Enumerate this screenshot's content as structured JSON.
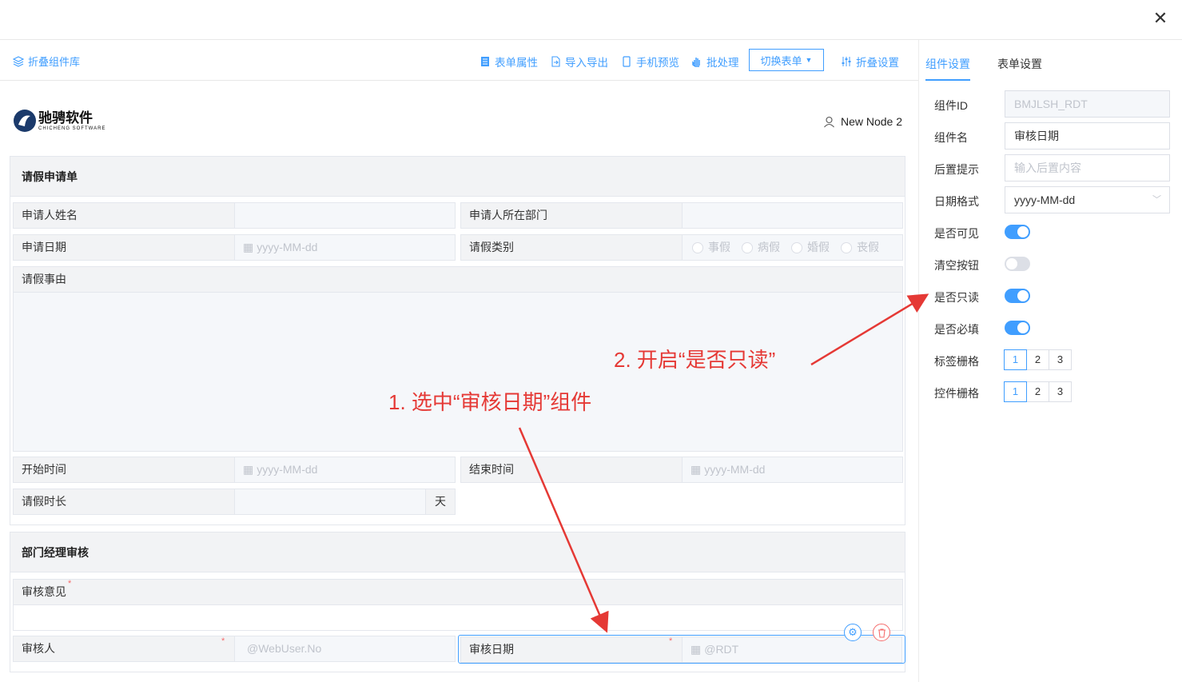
{
  "window": {
    "close_icon": "close-icon"
  },
  "toolbar": {
    "fold_lib": "折叠组件库",
    "form_props": "表单属性",
    "import_export": "导入导出",
    "mobile_preview": "手机预览",
    "batch": "批处理",
    "switch_form": "切换表单",
    "fold_settings": "折叠设置"
  },
  "header": {
    "logo_title": "驰骋软件",
    "logo_sub": "CHICHENG SOFTWARE",
    "node": "New Node 2"
  },
  "section1": {
    "title": "请假申请单",
    "applicant_name": "申请人姓名",
    "applicant_dept": "申请人所在部门",
    "apply_date": "申请日期",
    "date_ph": "yyyy-MM-dd",
    "leave_type": "请假类别",
    "leave_options": [
      "事假",
      "病假",
      "婚假",
      "丧假"
    ],
    "reason": "请假事由",
    "start_time": "开始时间",
    "end_time": "结束时间",
    "duration": "请假时长",
    "duration_unit": "天"
  },
  "section2": {
    "title": "部门经理审核",
    "opinion": "审核意见",
    "reviewer": "审核人",
    "reviewer_value": "@WebUser.No",
    "review_date": "审核日期",
    "review_date_value": "@RDT",
    "required_mark": "*"
  },
  "panel": {
    "tab_component": "组件设置",
    "tab_form": "表单设置",
    "id_label": "组件ID",
    "id_value": "BMJLSH_RDT",
    "name_label": "组件名",
    "name_value": "审核日期",
    "hint_label": "后置提示",
    "hint_ph": "输入后置内容",
    "format_label": "日期格式",
    "format_value": "yyyy-MM-dd",
    "visible_label": "是否可见",
    "visible": true,
    "clear_label": "清空按钮",
    "clear": false,
    "readonly_label": "是否只读",
    "readonly": true,
    "required_label": "是否必填",
    "required": true,
    "label_grid_label": "标签栅格",
    "label_grid_options": [
      "1",
      "2",
      "3"
    ],
    "label_grid_selected": "1",
    "ctrl_grid_label": "控件栅格",
    "ctrl_grid_options": [
      "1",
      "2",
      "3"
    ],
    "ctrl_grid_selected": "1"
  },
  "annotations": {
    "step1": "1. 选中“审核日期”组件",
    "step2": "2. 开启“是否只读”"
  },
  "colors": {
    "accent": "#409eff",
    "annotation": "#e53935",
    "danger": "#f56c6c"
  }
}
